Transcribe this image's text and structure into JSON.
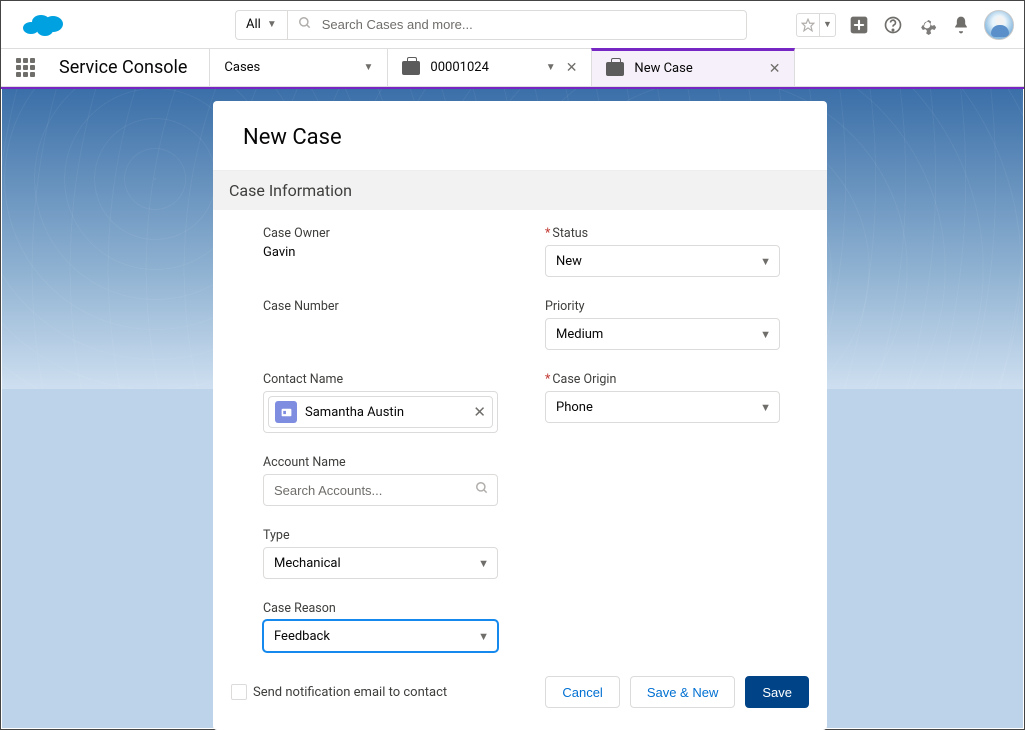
{
  "header": {
    "scope_label": "All",
    "search_placeholder": "Search Cases and more..."
  },
  "nav": {
    "app_name": "Service Console",
    "tab_main": "Cases",
    "tab_record": "00001024",
    "tab_active": "New Case"
  },
  "modal": {
    "title": "New Case",
    "section": "Case Information",
    "fields": {
      "case_owner": {
        "label": "Case Owner",
        "value": "Gavin"
      },
      "status": {
        "label": "Status",
        "value": "New",
        "required": true
      },
      "case_number": {
        "label": "Case Number",
        "value": ""
      },
      "priority": {
        "label": "Priority",
        "value": "Medium"
      },
      "contact_name": {
        "label": "Contact Name",
        "value": "Samantha Austin"
      },
      "case_origin": {
        "label": "Case Origin",
        "value": "Phone",
        "required": true
      },
      "account_name": {
        "label": "Account Name",
        "placeholder": "Search Accounts..."
      },
      "type": {
        "label": "Type",
        "value": "Mechanical"
      },
      "case_reason": {
        "label": "Case Reason",
        "value": "Feedback"
      }
    },
    "notification_label": "Send notification email to contact",
    "buttons": {
      "cancel": "Cancel",
      "save_new": "Save & New",
      "save": "Save"
    }
  }
}
